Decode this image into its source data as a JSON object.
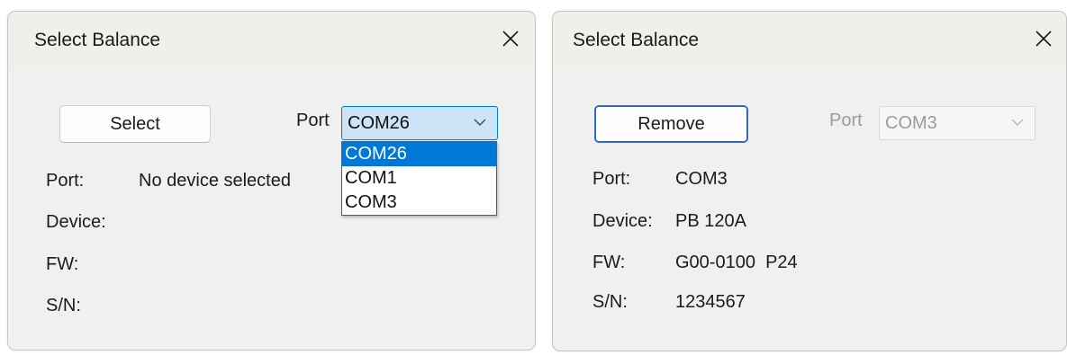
{
  "left_dialog": {
    "title": "Select Balance",
    "select_button": "Select",
    "port_label": "Port",
    "port_combo_value": "COM26",
    "port_options": [
      "COM26",
      "COM1",
      "COM3"
    ],
    "port_options_selected": "COM26",
    "info": {
      "port_label": "Port:",
      "port_value": "No device selected",
      "device_label": "Device:",
      "device_value": "",
      "fw_label": "FW:",
      "fw_value": "",
      "sn_label": "S/N:",
      "sn_value": ""
    }
  },
  "right_dialog": {
    "title": "Select Balance",
    "remove_button": "Remove",
    "port_label": "Port",
    "port_combo_value": "COM3",
    "info": {
      "port_label": "Port:",
      "port_value": "COM3",
      "device_label": "Device:",
      "device_value": "PB 120A",
      "fw_label": "FW:",
      "fw_value": "G00-0100  P24",
      "sn_label": "S/N:",
      "sn_value": "1234567"
    }
  },
  "icons": {
    "close": "close-icon",
    "dropdown": "chevron-down-icon"
  },
  "colors": {
    "dialog_background": "#f0f0f0",
    "titlebar_background": "#eef0ea",
    "combo_focus_background": "#cce4f7",
    "combo_focus_border": "#0078d4",
    "selected_item_background": "#0078d7",
    "disabled_text": "#9c9c9c",
    "default_button_border": "#2c5cc5"
  }
}
